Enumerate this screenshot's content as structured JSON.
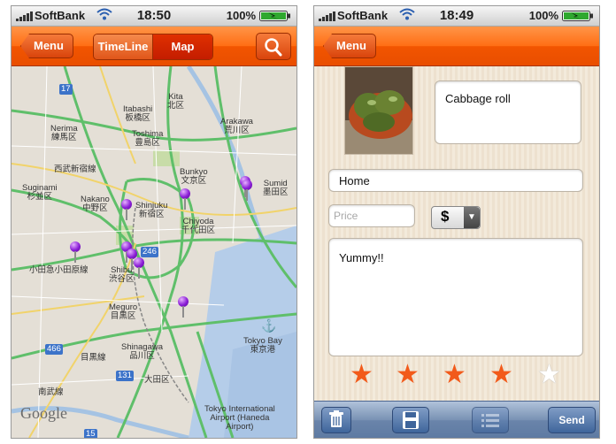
{
  "status_left": {
    "carrier": "SoftBank",
    "time": "18:50",
    "battery": "100%"
  },
  "status_right": {
    "carrier": "SoftBank",
    "time": "18:49",
    "battery": "100%"
  },
  "map_screen": {
    "menu_label": "Menu",
    "segments": {
      "timeline": "TimeLine",
      "map": "Map"
    },
    "map_labels": [
      {
        "id": "kita",
        "text": "Kita\n北区"
      },
      {
        "id": "itabashi",
        "text": "Itabashi\n板橋区"
      },
      {
        "id": "arakawa",
        "text": "Arakawa\n荒川区"
      },
      {
        "id": "nerima",
        "text": "Nerima\n練馬区"
      },
      {
        "id": "toshima",
        "text": "Toshima\n豊島区"
      },
      {
        "id": "nishi-shinjuku",
        "text": "西武新宿線"
      },
      {
        "id": "bunkyo",
        "text": "Bunkyo\n文京区"
      },
      {
        "id": "suginami",
        "text": "Suginami\n杉並区"
      },
      {
        "id": "nakano",
        "text": "Nakano\n中野区"
      },
      {
        "id": "shinjuku",
        "text": "Shinjuku\n新宿区"
      },
      {
        "id": "chiyoda",
        "text": "Chiyoda\n千代田区"
      },
      {
        "id": "sumida",
        "text": "Sumid\n墨田区"
      },
      {
        "id": "odakyu",
        "text": "小田急小田原線"
      },
      {
        "id": "shibuya",
        "text": "Shibu\n渋谷区"
      },
      {
        "id": "meguro",
        "text": "Meguro\n目黒区"
      },
      {
        "id": "shinagawa",
        "text": "Shinagawa\n品川区"
      },
      {
        "id": "meguro-line",
        "text": "目黒線"
      },
      {
        "id": "tokyo-bay",
        "text": "Tokyo Bay\n東京港"
      },
      {
        "id": "ota",
        "text": "大田区"
      },
      {
        "id": "nambu",
        "text": "南武線"
      },
      {
        "id": "airport",
        "text": "Tokyo International\nAirport (Haneda\nAirport)"
      },
      {
        "id": "route-17",
        "text": "17"
      },
      {
        "id": "route-246",
        "text": "246"
      },
      {
        "id": "route-466",
        "text": "466"
      },
      {
        "id": "route-131",
        "text": "131"
      },
      {
        "id": "route-15",
        "text": "15"
      }
    ],
    "attribution": "Google"
  },
  "detail_screen": {
    "menu_label": "Menu",
    "name_value": "Cabbage roll",
    "place_value": "Home",
    "price_placeholder": "Price",
    "currency": "$",
    "comment_value": "Yummy!!",
    "rating": 4,
    "rating_max": 5,
    "send_label": "Send"
  },
  "colors": {
    "navbar_accent": "#f25500",
    "pin": "#8a1ed6",
    "star_filled": "#f25a1a"
  }
}
